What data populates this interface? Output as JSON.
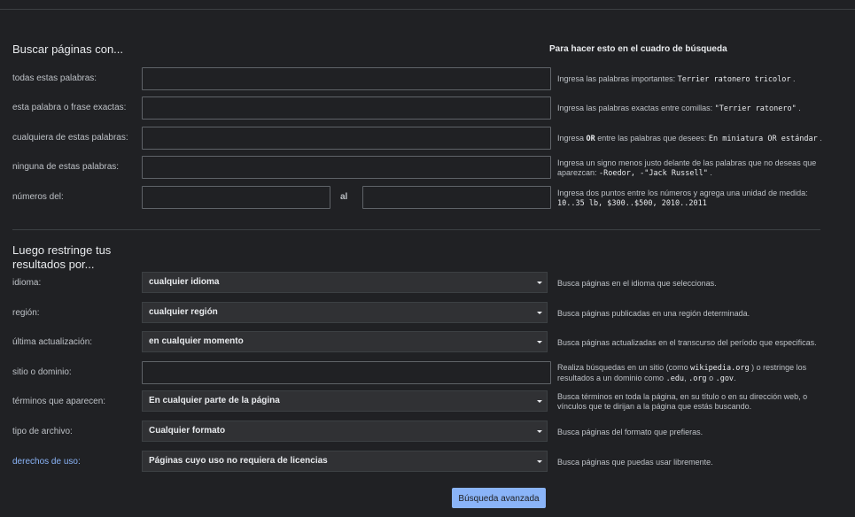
{
  "section1": {
    "title": "Buscar páginas con...",
    "hint_heading": "Para hacer esto en el cuadro de búsqueda"
  },
  "fields": {
    "all_words": {
      "label": "todas estas palabras:",
      "value": "",
      "hint_text": "Ingresa las palabras importantes: ",
      "hint_code": "Terrier ratonero tricolor",
      "hint_end": "."
    },
    "exact_phrase": {
      "label": "esta palabra o frase exactas:",
      "value": "",
      "hint_text": "Ingresa las palabras exactas entre comillas: ",
      "hint_code": "\"Terrier ratonero\"",
      "hint_end": "."
    },
    "any_words": {
      "label": "cualquiera de estas palabras:",
      "value": "",
      "hint_pre": "Ingresa ",
      "hint_or": "OR",
      "hint_mid": " entre las palabras que desees: ",
      "hint_code": "En miniatura OR estándar",
      "hint_end": "."
    },
    "none_words": {
      "label": "ninguna de estas palabras:",
      "value": "",
      "hint_text": "Ingresa un signo menos justo delante de las palabras que no deseas que aparezcan: ",
      "hint_code": "-Roedor, -\"Jack Russell\"",
      "hint_end": "."
    },
    "numbers": {
      "label": "números del:",
      "from_value": "",
      "to_label": "al",
      "to_value": "",
      "hint_text": "Ingresa dos puntos entre los números y agrega una unidad de medida: ",
      "hint_code": "10..35 lb, $300..$500, 2010..2011"
    }
  },
  "section2": {
    "title_line1": "Luego restringe tus",
    "title_line2": "resultados por..."
  },
  "filters": {
    "language": {
      "label": "idioma:",
      "value": "cualquier idioma",
      "hint": "Busca páginas en el idioma que seleccionas."
    },
    "region": {
      "label": "región:",
      "value": "cualquier región",
      "hint": "Busca páginas publicadas en una región determinada."
    },
    "last_update": {
      "label": "última actualización:",
      "value": "en cualquier momento",
      "hint": "Busca páginas actualizadas en el transcurso del período que especificas."
    },
    "site": {
      "label": "sitio o dominio:",
      "value": "",
      "hint_a": "Realiza búsquedas en un sitio (como ",
      "hint_code1": "wikipedia.org",
      "hint_b": " ) o restringe los resultados a un dominio como ",
      "hint_code2": ".edu",
      "hint_c": ", ",
      "hint_code3": ".org",
      "hint_d": " o ",
      "hint_code4": ".gov",
      "hint_e": "."
    },
    "terms_appearing": {
      "label": "términos que aparecen:",
      "value": "En cualquier parte de la página",
      "hint": "Busca términos en toda la página, en su título o en su dirección web, o vínculos que te dirijan a la página que estás buscando."
    },
    "file_type": {
      "label": "tipo de archivo:",
      "value": "Cualquier formato",
      "hint": "Busca páginas del formato que prefieras."
    },
    "usage_rights": {
      "label": "derechos de uso:",
      "value": "Páginas cuyo uso no requiera de licencias",
      "hint": "Busca páginas que puedas usar libremente."
    }
  },
  "submit_label": "Búsqueda avanzada",
  "colors": {
    "background": "#202124",
    "accent": "#8ab4f8",
    "text": "#bdc1c6"
  },
  "icons": {
    "select_arrow": "dropdown-arrow-icon"
  }
}
